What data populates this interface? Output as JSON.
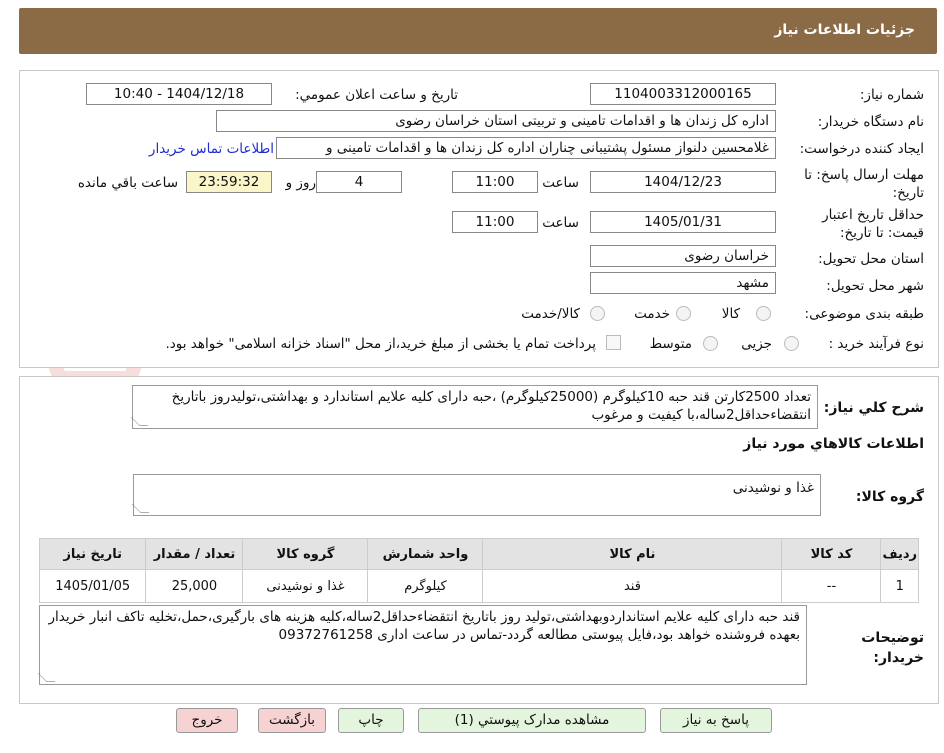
{
  "header": {
    "title": "جزئیات اطلاعات نیاز"
  },
  "form": {
    "need_number": {
      "label": "شماره نیاز:",
      "value": "1104003312000165"
    },
    "announce": {
      "label": "تاریخ و ساعت اعلان عمومي:",
      "value": "1404/12/18 - 10:40"
    },
    "buyer_org": {
      "label": "نام دستگاه خریدار:",
      "value": "اداره کل زندان ها و اقدامات تامینی و تربیتی استان خراسان رضوی"
    },
    "requester": {
      "label": "ایجاد کننده درخواست:",
      "value": "غلامحسین دلنواز مسئول پشتیبانی چناران اداره کل زندان ها و اقدامات تامینی و",
      "link": "اطلاعات تماس خریدار"
    },
    "deadline": {
      "label": "مهلت ارسال پاسخ: تا تاریخ:",
      "date": "1404/12/23",
      "time_label": "ساعت",
      "time": "11:00",
      "days": "4",
      "days_label": "روز و",
      "remaining": "23:59:32",
      "remaining_label": "ساعت باقي مانده"
    },
    "validity": {
      "label": "حداقل تاريخ اعتبار قيمت: تا تاريخ:",
      "date": "1405/01/31",
      "time_label": "ساعت",
      "time": "11:00"
    },
    "province": {
      "label": "استان محل تحویل:",
      "value": "خراسان رضوی"
    },
    "city": {
      "label": "شهر محل تحویل:",
      "value": "مشهد"
    },
    "category": {
      "label": "طبقه بندی موضوعی:",
      "options": [
        "کالا",
        "خدمت",
        "کالا/خدمت"
      ]
    },
    "process": {
      "label": "نوع فرآیند خرید :",
      "options": [
        "جزیی",
        "متوسط"
      ],
      "payment_note": "پرداخت تمام یا بخشی از مبلغ خرید،از محل \"اسناد خزانه اسلامی\" خواهد بود."
    }
  },
  "summary": {
    "label": "شرح کلي نياز:",
    "text": "تعداد 2500کارتن قند حبه 10کیلوگرم (25000کیلوگرم) ،حبه  دارای کلیه علایم استاندارد و بهداشتی،تولیدروز باتاریخ انتقضاءحداقل2ساله،با کیفیت و مرغوب"
  },
  "goods": {
    "title": "اطلاعات کالاهاي مورد نياز",
    "group_label": "گروه کالا:",
    "group_value": "غذا و نوشیدنی",
    "columns": [
      "رديف",
      "کد کالا",
      "نام کالا",
      "واحد شمارش",
      "گروه کالا",
      "تعداد / مقدار",
      "تاریخ نیاز"
    ],
    "rows": [
      {
        "row": "1",
        "code": "--",
        "name": "قند",
        "unit": "کیلوگرم",
        "group": "غذا و نوشیدنی",
        "qty": "25,000",
        "date": "1405/01/05"
      }
    ]
  },
  "buyer_notes": {
    "label": "توضیحات خریدار:",
    "text": "قند حبه دارای کلیه علایم استانداردوبهداشتی،تولید روز باتاریخ انتقضاءحداقل2ساله،کلیه هزینه های بارگیری،حمل،تخلیه تاکف انبار خریدار بعهده فروشنده خواهد بود،فایل پیوستی مطالعه گردد-تماس در ساعت اداری 09372761258"
  },
  "buttons": {
    "reply": "پاسخ به نیاز",
    "docs": "مشاهده مدارک پیوستي (1)",
    "print": "چاپ",
    "back": "بازگشت",
    "exit": "خروج"
  },
  "colors": {
    "header": "#8b6b45",
    "link": "#1e2bd6",
    "yellow": "#fbf6c9",
    "green_btn": "#e3f5dc",
    "pink_btn": "#f7d2d2"
  }
}
